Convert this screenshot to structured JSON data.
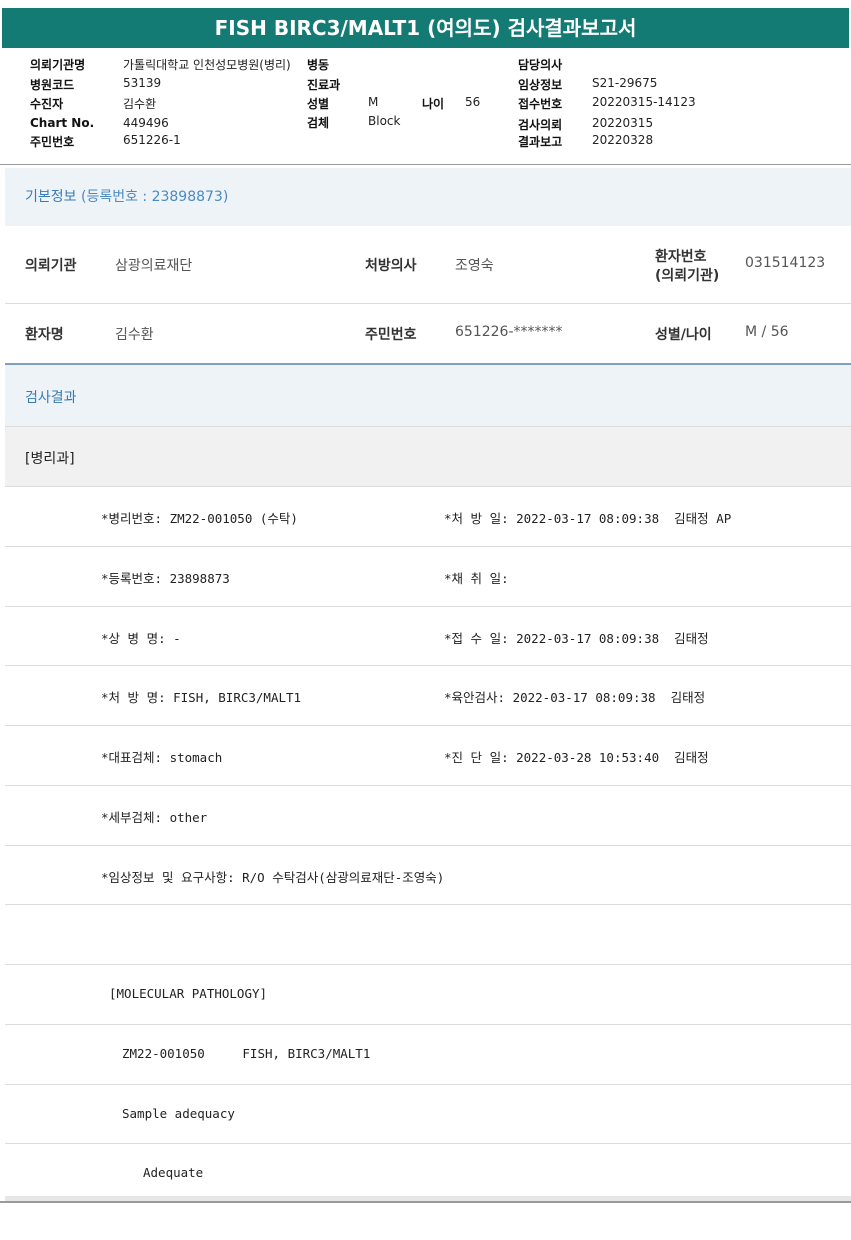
{
  "title": "FISH BIRC3/MALT1 (여의도) 검사결과보고서",
  "header": {
    "institution_label": "의뢰기관명",
    "institution_value": "가톨릭대학교 인천성모병원(병리)",
    "ward_label": "병동",
    "doctor_label": "담당의사",
    "doctor_value": "",
    "hospital_code_label": "병원코드",
    "hospital_code_value": "53139",
    "dept_label": "진료과",
    "dept_value": "",
    "clinical_label": "임상정보",
    "clinical_value": "S21-29675",
    "patient_label": "수진자",
    "patient_value": "김수환",
    "sex_label": "성별",
    "sex_value": "M",
    "age_label": "나이",
    "age_value": "56",
    "receipt_label": "접수번호",
    "receipt_value": "20220315-14123",
    "chart_label": "Chart No.",
    "chart_value": "449496",
    "specimen_label": "검체",
    "specimen_value": "Block",
    "request_label": "검사의뢰",
    "request_value": "20220315",
    "rrn_label": "주민번호",
    "rrn_value": "651226-1",
    "report_label": "결과보고",
    "report_value": "20220328"
  },
  "basic_info": {
    "title": "기본정보",
    "subtitle": "(등록번호 : 23898873)",
    "institution_label": "의뢰기관",
    "institution_value": "삼광의료재단",
    "prescriber_label": "처방의사",
    "prescriber_value": "조영숙",
    "patient_no_label_1": "환자번호",
    "patient_no_label_2": "(의뢰기관)",
    "patient_no_value": "031514123",
    "patient_name_label": "환자명",
    "patient_name_value": "김수환",
    "rrn_label": "주민번호",
    "rrn_value": "651226-*******",
    "sex_age_label": "성별/나이",
    "sex_age_value": "M / 56"
  },
  "results": {
    "title": "검사결과",
    "department": "[병리과]",
    "lines": [
      {
        "left": "*병리번호: ZM22-001050 (수탁)",
        "right": "*처 방 일: 2022-03-17 08:09:38  김태정 AP"
      },
      {
        "left": "*등록번호: 23898873",
        "right": "*채 취 일:"
      },
      {
        "left": "*상 병 명: -",
        "right": "*접 수 일: 2022-03-17 08:09:38  김태정"
      },
      {
        "left": "*처 방 명: FISH, BIRC3/MALT1",
        "right": "*육안검사: 2022-03-17 08:09:38  김태정"
      },
      {
        "left": "*대표검체: stomach",
        "right": "*진 단 일: 2022-03-28 10:53:40  김태정"
      },
      {
        "left": "*세부검체: other",
        "right": ""
      },
      {
        "left": "*임상정보 및 요구사항: R/O 수탁검사(삼광의료재단-조영숙)",
        "right": ""
      }
    ],
    "molecular_title": "[MOLECULAR PATHOLOGY]",
    "molecular_line": "ZM22-001050     FISH, BIRC3/MALT1",
    "adequacy_label": "Sample adequacy",
    "adequacy_value": "Adequate"
  }
}
